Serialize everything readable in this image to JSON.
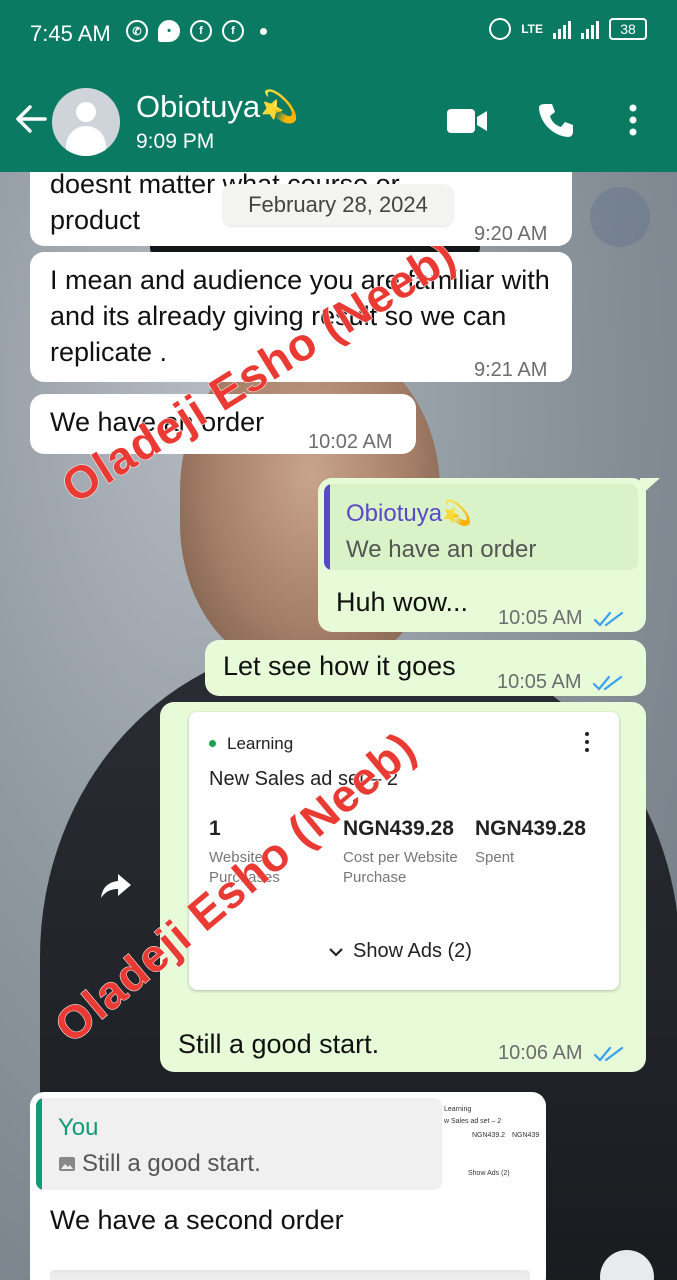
{
  "status_bar": {
    "time": "7:45 AM",
    "network": "LTE",
    "battery": "38"
  },
  "header": {
    "contact_name": "Obiotuya💫",
    "contact_status": "9:09 PM"
  },
  "date_chip": "February 28, 2024",
  "messages": [
    {
      "direction": "in",
      "text": "doesnt matter what course or product",
      "time": "9:20 AM"
    },
    {
      "direction": "in",
      "text": "I mean and audience you are familiar with and its already giving result so we can replicate .",
      "time": "9:21 AM"
    },
    {
      "direction": "in",
      "text": "We have an order",
      "time": "10:02 AM"
    },
    {
      "direction": "out",
      "quote_author": "Obiotuya💫",
      "quote_text": "We have an order",
      "text": "Huh wow...",
      "time": "10:05 AM",
      "read": true
    },
    {
      "direction": "out",
      "text": "Let see how it goes",
      "time": "10:05 AM",
      "read": true
    },
    {
      "direction": "out",
      "text": "Still a good start.",
      "time": "10:06 AM",
      "read": true
    },
    {
      "direction": "in",
      "quote_author": "You",
      "quote_text": "Still a good start.",
      "text": "We have a second order"
    }
  ],
  "ad_card": {
    "status": "Learning",
    "title": "New Sales ad set – 2",
    "metrics": [
      {
        "value": "1",
        "label": "Website Purchases"
      },
      {
        "value": "NGN439.28",
        "label": "Cost per Website Purchase"
      },
      {
        "value": "NGN439.28",
        "label": "Spent"
      }
    ],
    "show_ads": "Show Ads (2)"
  },
  "thumbnail": {
    "status": "Learning",
    "title": "w Sales ad set – 2",
    "values": [
      "NGN439.2",
      "NGN439"
    ],
    "show_ads": "Show Ads (2)"
  },
  "watermark": "Oladeji Esho (Neeb)",
  "colors": {
    "header": "#0b7a62",
    "incoming": "#ffffff",
    "outgoing": "#e7fbd9",
    "read_ticks": "#3aa0f0",
    "watermark": "#ea3a34"
  }
}
